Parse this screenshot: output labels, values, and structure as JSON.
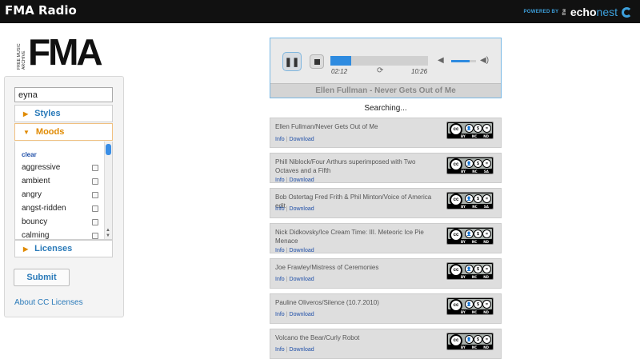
{
  "header": {
    "app_title": "FMA Radio",
    "powered_small": "POWERED BY",
    "powered_the": "the",
    "powered_echo": "echo",
    "powered_nest": "nest",
    "accent": "#3da0dc"
  },
  "logo": {
    "text": "FMA",
    "vertical": "FREE MUSIC ARCHIVE"
  },
  "sidebar": {
    "search_value": "eyna",
    "styles_label": "Styles",
    "moods_label": "Moods",
    "clear_label": "clear",
    "moods": [
      "aggressive",
      "ambient",
      "angry",
      "angst-ridden",
      "bouncy",
      "calming"
    ],
    "licenses_label": "Licenses",
    "submit_label": "Submit",
    "about_link": "About CC Licenses"
  },
  "player": {
    "current_time": "02:12",
    "total_time": "10:26",
    "progress": 0.21,
    "volume": 0.75,
    "now_playing": "Ellen Fullman - Never Gets Out of Me",
    "accent": "#2e8be0"
  },
  "status": "Searching...",
  "tracks": [
    {
      "title": "Ellen Fullman/Never Gets Out of Me",
      "info": "Info",
      "download": "Download",
      "license": [
        "BY",
        "NC",
        "ND"
      ]
    },
    {
      "title": "Phill Niblock/Four Arthurs superimposed with Two Octaves and a Fifth",
      "info": "Info",
      "download": "Download",
      "license": [
        "BY",
        "NC",
        "SA"
      ]
    },
    {
      "title": "Bob Ostertag Fred Frith & Phil Minton/Voice of America edit",
      "info": "Info",
      "download": "Download",
      "license": [
        "BY",
        "NC",
        "SA"
      ]
    },
    {
      "title": "Nick Didkovsky/Ice Cream Time: III. Meteoric Ice Pie Menace",
      "info": "Info",
      "download": "Download",
      "license": [
        "BY",
        "NC",
        "ND"
      ]
    },
    {
      "title": "Joe Frawley/Mistress of Ceremonies",
      "info": "Info",
      "download": "Download",
      "license": [
        "BY",
        "NC",
        "ND"
      ]
    },
    {
      "title": "Pauline Oliveros/Silence (10.7.2010)",
      "info": "Info",
      "download": "Download",
      "license": [
        "BY",
        "NC",
        "ND"
      ]
    },
    {
      "title": "Volcano the Bear/Curly Robot",
      "info": "Info",
      "download": "Download",
      "license": [
        "BY",
        "NC",
        "ND"
      ]
    }
  ]
}
